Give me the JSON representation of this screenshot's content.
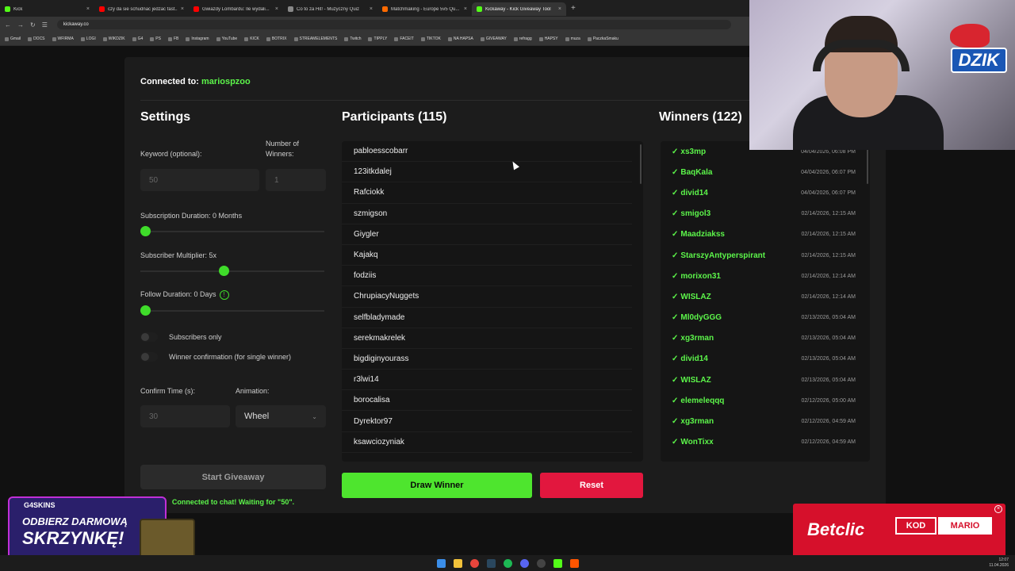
{
  "browser": {
    "tabs": [
      {
        "title": "Kick",
        "color": "#53fc18",
        "active": false
      },
      {
        "title": "czy da sie schudnac jedzac fast...",
        "color": "#ff0000",
        "active": false
      },
      {
        "title": "Gwiazdy Lombardu: Ile wydali...",
        "color": "#ff0000",
        "active": false
      },
      {
        "title": "Co to za Hit! - Muzyczny Quiz",
        "color": "#888888",
        "active": false
      },
      {
        "title": "Matchmaking - Europe 5v5 Qu...",
        "color": "#ff6a00",
        "active": false
      },
      {
        "title": "Kickaway - Kick Giveaway Tool",
        "color": "#53fc18",
        "active": true
      }
    ],
    "url": "kickaway.co",
    "bookmarks": [
      "Gmail",
      "DOCS",
      "WFIRMA",
      "LOGI",
      "WIKDZIK",
      "G4",
      "PS",
      "FB",
      "Instagram",
      "YouTube",
      "KICK",
      "BOTRIX",
      "STREAMELEMENTS",
      "Twitch",
      "TIPPLY",
      "FACEIT",
      "TIKTOK",
      "NA HAPSA",
      "GIVEAWAY",
      "refragg",
      "HAPSY",
      "muza",
      "PaczkaSmaku"
    ]
  },
  "connection": {
    "label": "Connected to:",
    "user": "mariospzoo"
  },
  "settings": {
    "title": "Settings",
    "keyword_label": "Keyword (optional):",
    "keyword_value": "50",
    "winners_label": "Number of Winners:",
    "winners_value": "1",
    "sub_duration_label": "Subscription Duration: 0 Months",
    "sub_duration_value": 0,
    "sub_multiplier_label": "Subscriber Multiplier: 5x",
    "sub_multiplier_value": 0.45,
    "follow_duration_label": "Follow Duration:  0  Days",
    "follow_duration_value": 0,
    "info_glyph": "!",
    "subscribers_only_label": "Subscribers only",
    "winner_confirmation_label": "Winner confirmation (for single winner)",
    "confirm_time_label": "Confirm Time (s):",
    "confirm_time_value": "30",
    "animation_label": "Animation:",
    "animation_value": "Wheel",
    "start_button": "Start Giveaway",
    "status": "Connected to chat! Waiting for \"50\"."
  },
  "participants": {
    "title": "Participants (115)",
    "items": [
      "pabloesscobarr",
      "123itkdalej",
      "Rafciokk",
      "szmigson",
      "Giygler",
      "Kajakq",
      "fodziis",
      "ChrupiacyNuggets",
      "selfbladymade",
      "serekmakrelek",
      "bigdiginyourass",
      "r3lwi14",
      "borocalisa",
      "Dyrektor97",
      "ksawciozyniak"
    ]
  },
  "winners": {
    "title": "Winners (122)",
    "check": "✓",
    "items": [
      {
        "name": "xs3mp",
        "date": "04/04/2026, 06:08 PM"
      },
      {
        "name": "BaqKala",
        "date": "04/04/2026, 06:07 PM"
      },
      {
        "name": "divid14",
        "date": "04/04/2026, 06:07 PM"
      },
      {
        "name": "smigol3",
        "date": "02/14/2026, 12:15 AM"
      },
      {
        "name": "Maadziakss",
        "date": "02/14/2026, 12:15 AM"
      },
      {
        "name": "StarszyAntyperspirant",
        "date": "02/14/2026, 12:15 AM"
      },
      {
        "name": "morixon31",
        "date": "02/14/2026, 12:14 AM"
      },
      {
        "name": "WISLAZ",
        "date": "02/14/2026, 12:14 AM"
      },
      {
        "name": "Ml0dyGGG",
        "date": "02/13/2026, 05:04 AM"
      },
      {
        "name": "xg3rman",
        "date": "02/13/2026, 05:04 AM"
      },
      {
        "name": "divid14",
        "date": "02/13/2026, 05:04 AM"
      },
      {
        "name": "WISLAZ",
        "date": "02/13/2026, 05:04 AM"
      },
      {
        "name": "elemeleqqq",
        "date": "02/12/2026, 05:00 AM"
      },
      {
        "name": "xg3rman",
        "date": "02/12/2026, 04:59 AM"
      },
      {
        "name": "WonTixx",
        "date": "02/12/2026, 04:59 AM"
      }
    ]
  },
  "actions": {
    "draw": "Draw Winner",
    "reset": "Reset"
  },
  "overlays": {
    "dzik": "DZIK",
    "promo_brand": "G4SKINS",
    "promo_line1": "ODBIERZ DARMOWĄ",
    "promo_line2": "SKRZYNKĘ!",
    "betclic_name": "Betclic",
    "betclic_kod": "KOD",
    "betclic_code": "MARIO",
    "close_glyph": "×"
  },
  "taskbar": {
    "time": "12:07",
    "date": "11.04.2026"
  },
  "colors": {
    "accent": "#4ee52e",
    "reset": "#e2173e",
    "winner": "#5cf54a"
  }
}
